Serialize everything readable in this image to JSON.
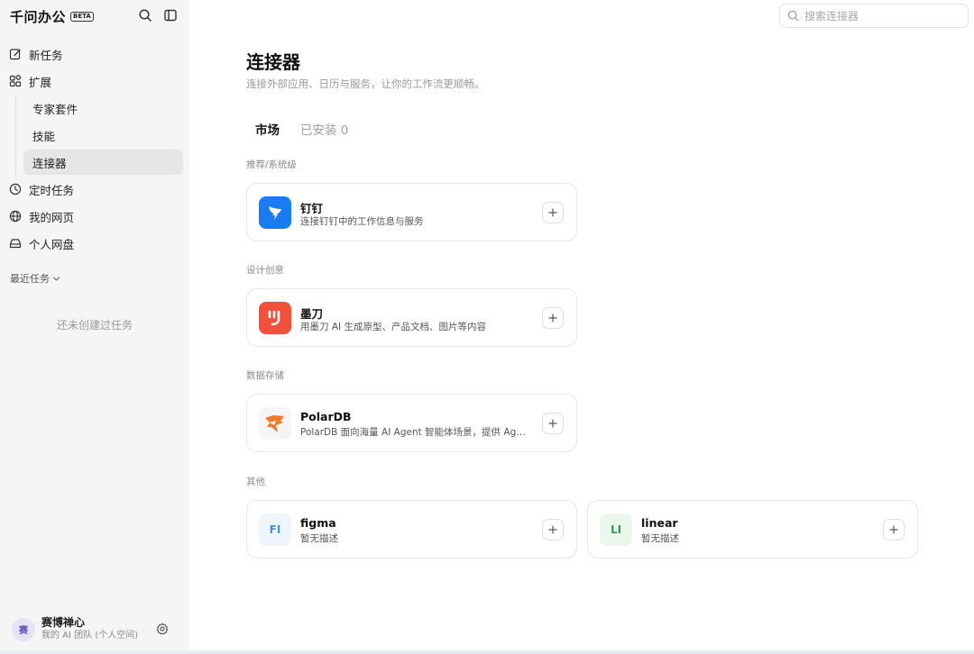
{
  "app": {
    "name": "千问办公",
    "badge": "BETA"
  },
  "sidebar": {
    "new_task": "新任务",
    "extend": "扩展",
    "sub_items": [
      "专家套件",
      "技能",
      "连接器"
    ],
    "scheduled": "定时任务",
    "my_pages": "我的网页",
    "drive": "个人网盘",
    "recent": "最近任务",
    "empty": "还未创建过任务"
  },
  "user": {
    "avatar": "赛",
    "name": "赛博禅心",
    "sub": "我的 AI 团队 (个人空间)"
  },
  "search": {
    "placeholder": "搜索连接器"
  },
  "main": {
    "title": "连接器",
    "subtitle": "连接外部应用、日历与服务，让你的工作流更顺畅。",
    "tabs": {
      "market": "市场",
      "installed": "已安装 0"
    },
    "sections": [
      "推荐/系统级",
      "设计创意",
      "数据存储",
      "其他"
    ],
    "cards": [
      {
        "name": "钉钉",
        "desc": "连接钉钉中的工作信息与服务",
        "icon": "dingtalk-icon"
      },
      {
        "name": "墨刀",
        "desc": "用墨刀 AI 生成原型、产品文档、图片等内容",
        "icon": "modao-icon"
      },
      {
        "name": "PolarDB",
        "desc": "PolarDB 面向海量 AI Agent 智能体场景，提供 Age...",
        "icon": "polardb-icon"
      },
      {
        "name": "figma",
        "desc": "暂无描述",
        "logo": "FI"
      },
      {
        "name": "linear",
        "desc": "暂无描述",
        "logo": "LI"
      }
    ]
  },
  "colors": {
    "dingtalk": "#1a7cf3",
    "modao": "#f0503c",
    "polardb": "#f07a2a",
    "sidebar_bg": "#f5f5f5"
  }
}
